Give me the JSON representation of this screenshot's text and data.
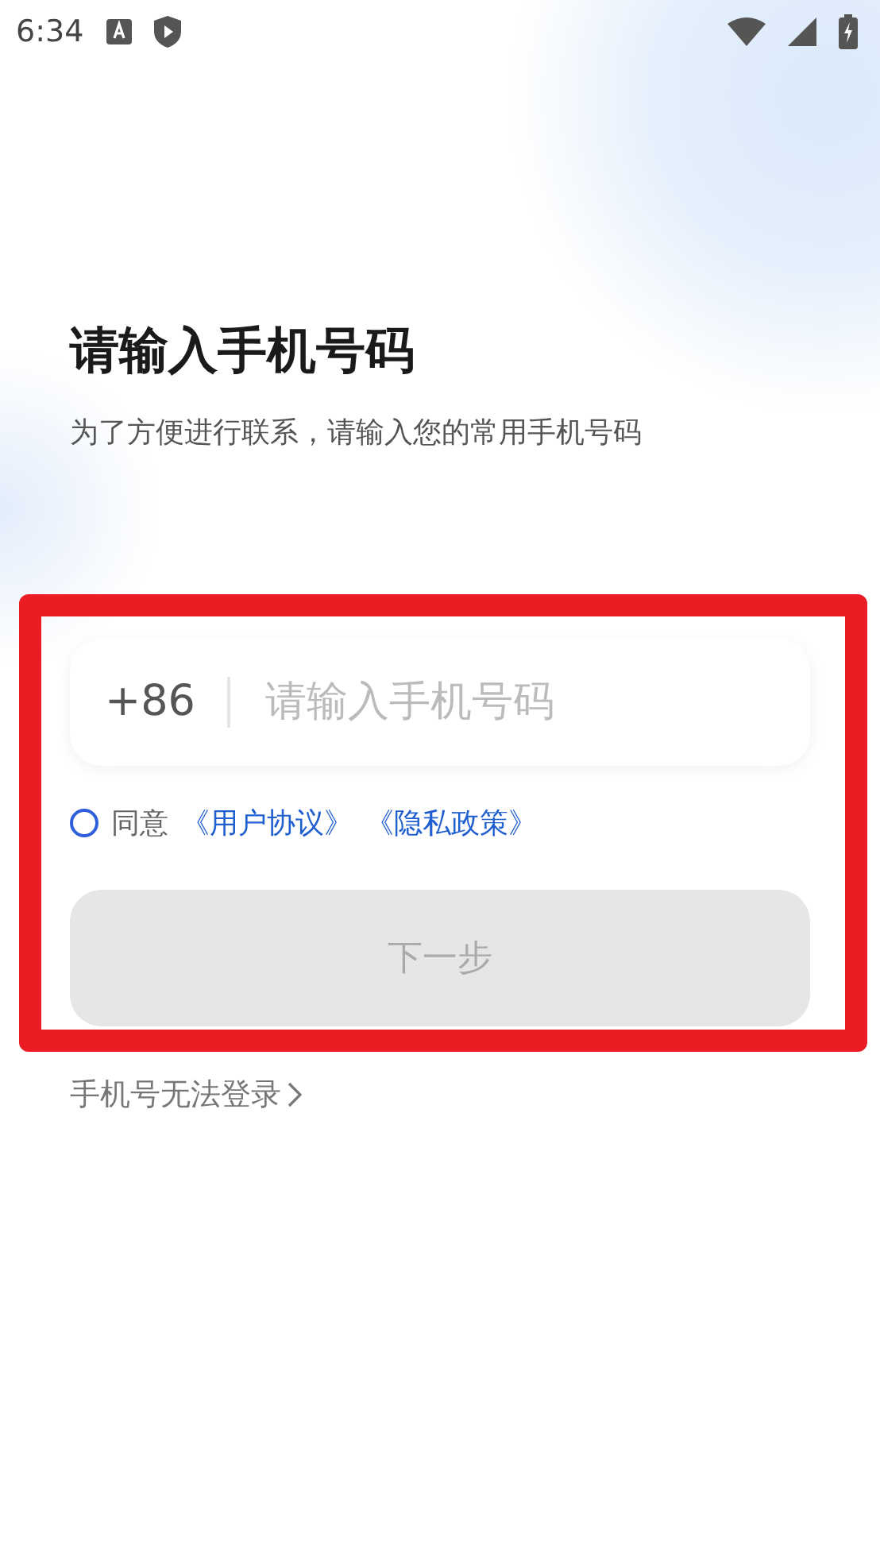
{
  "status_bar": {
    "time": "6:34"
  },
  "title": "请输入手机号码",
  "subtitle": "为了方便进行联系，请输入您的常用手机号码",
  "highlighted": true,
  "phone_field": {
    "country_code": "+86",
    "placeholder": "请输入手机号码"
  },
  "agreement": {
    "checked": false,
    "prefix": "同意",
    "links": [
      "《用户协议》",
      "《隐私政策》"
    ]
  },
  "next_button": {
    "label": "下一步",
    "disabled": true
  },
  "help_link": {
    "label": "手机号无法登录"
  }
}
